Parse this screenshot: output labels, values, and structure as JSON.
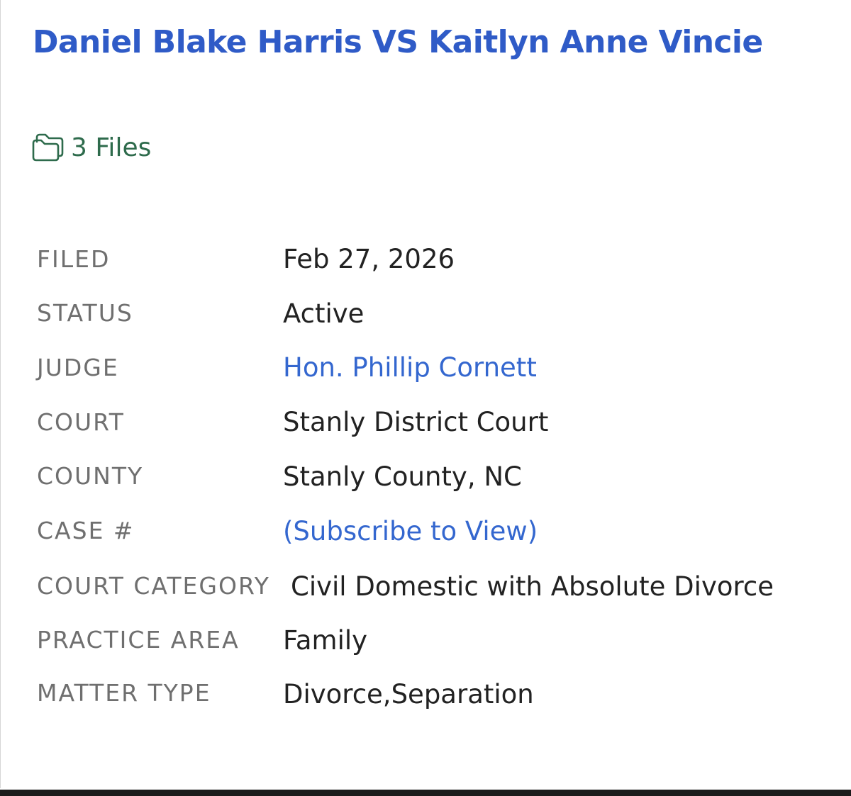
{
  "case": {
    "title": "Daniel Blake Harris VS Kaitlyn Anne Vincie",
    "files_label": "3 Files",
    "files_icon": "folder-icon"
  },
  "details": {
    "filed": {
      "label": "FILED",
      "value": "Feb 27, 2026"
    },
    "status": {
      "label": "STATUS",
      "value": "Active"
    },
    "judge": {
      "label": "JUDGE",
      "value": "Hon. Phillip Cornett"
    },
    "court": {
      "label": "COURT",
      "value": "Stanly District Court"
    },
    "county": {
      "label": "COUNTY",
      "value": "Stanly County, NC"
    },
    "case_number": {
      "label": "CASE #",
      "value": "(Subscribe to View)"
    },
    "court_category": {
      "label": "COURT CATEGORY",
      "value": "Civil Domestic with Absolute Divorce"
    },
    "practice_area": {
      "label": "PRACTICE AREA",
      "value": "Family"
    },
    "matter_type": {
      "label": "MATTER TYPE",
      "value": "Divorce,Separation"
    }
  },
  "colors": {
    "title_blue": "#2f5bc7",
    "link_blue": "#3467cf",
    "files_green": "#2e6b4c",
    "label_gray": "#6f6f6f",
    "value_dark": "#222222"
  }
}
